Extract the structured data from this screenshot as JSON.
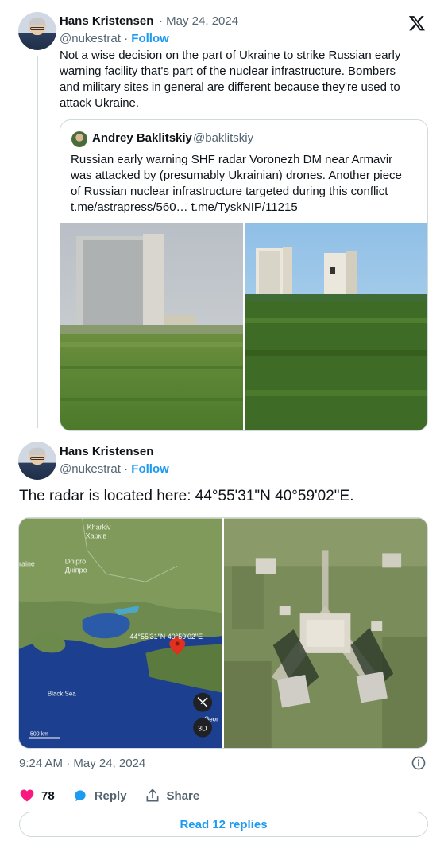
{
  "tweet1": {
    "author_name": "Hans Kristensen",
    "separator": "·",
    "date": "May 24, 2024",
    "handle": "@nukestrat",
    "dot": "·",
    "follow_label": "Follow",
    "text_lines": [
      "Not a wise decision on the part of Ukraine to strike Russian early",
      "warning facility that's part of the nuclear infrastructure. Bombers",
      "and military sites in general are different because they're used to",
      "attack Ukraine."
    ]
  },
  "quote": {
    "author_name": "Andrey Baklitskiy",
    "handle": "@baklitskiy",
    "text_lines": [
      "Russian early warning SHF radar Voronezh DM near Armavir",
      "was attacked by (presumably Ukrainian) drones. Another piece",
      "of Russian nuclear infrastructure targeted during this conflict",
      "t.me/astrapress/560… t.me/TyskNIP/11215"
    ]
  },
  "tweet2": {
    "author_name": "Hans Kristensen",
    "handle": "@nukestrat",
    "dot": "·",
    "follow_label": "Follow",
    "text": "The radar is located here: 44°55'31\"N 40°59'02\"E.",
    "map": {
      "labels": {
        "kharkiv": "Kharkiv",
        "kharkiv_cyr": "Харків",
        "dnipro": "Dnipro",
        "dnipro_cyr": "Дніпро",
        "ukraine": "raine",
        "coords": "44°55'31\"N 40°59'02\"E",
        "black_sea": "Black Sea",
        "scale": "500 km",
        "geor": "Geor",
        "btn_3d": "3D"
      }
    }
  },
  "footer": {
    "timestamp": "9:24 AM · May 24, 2024",
    "likes": "78",
    "reply_label": "Reply",
    "share_label": "Share",
    "read_replies": "Read 12 replies"
  },
  "colors": {
    "accent": "#1d9bf0",
    "like": "#f91880",
    "muted": "#536471",
    "border": "#cfd9de"
  }
}
